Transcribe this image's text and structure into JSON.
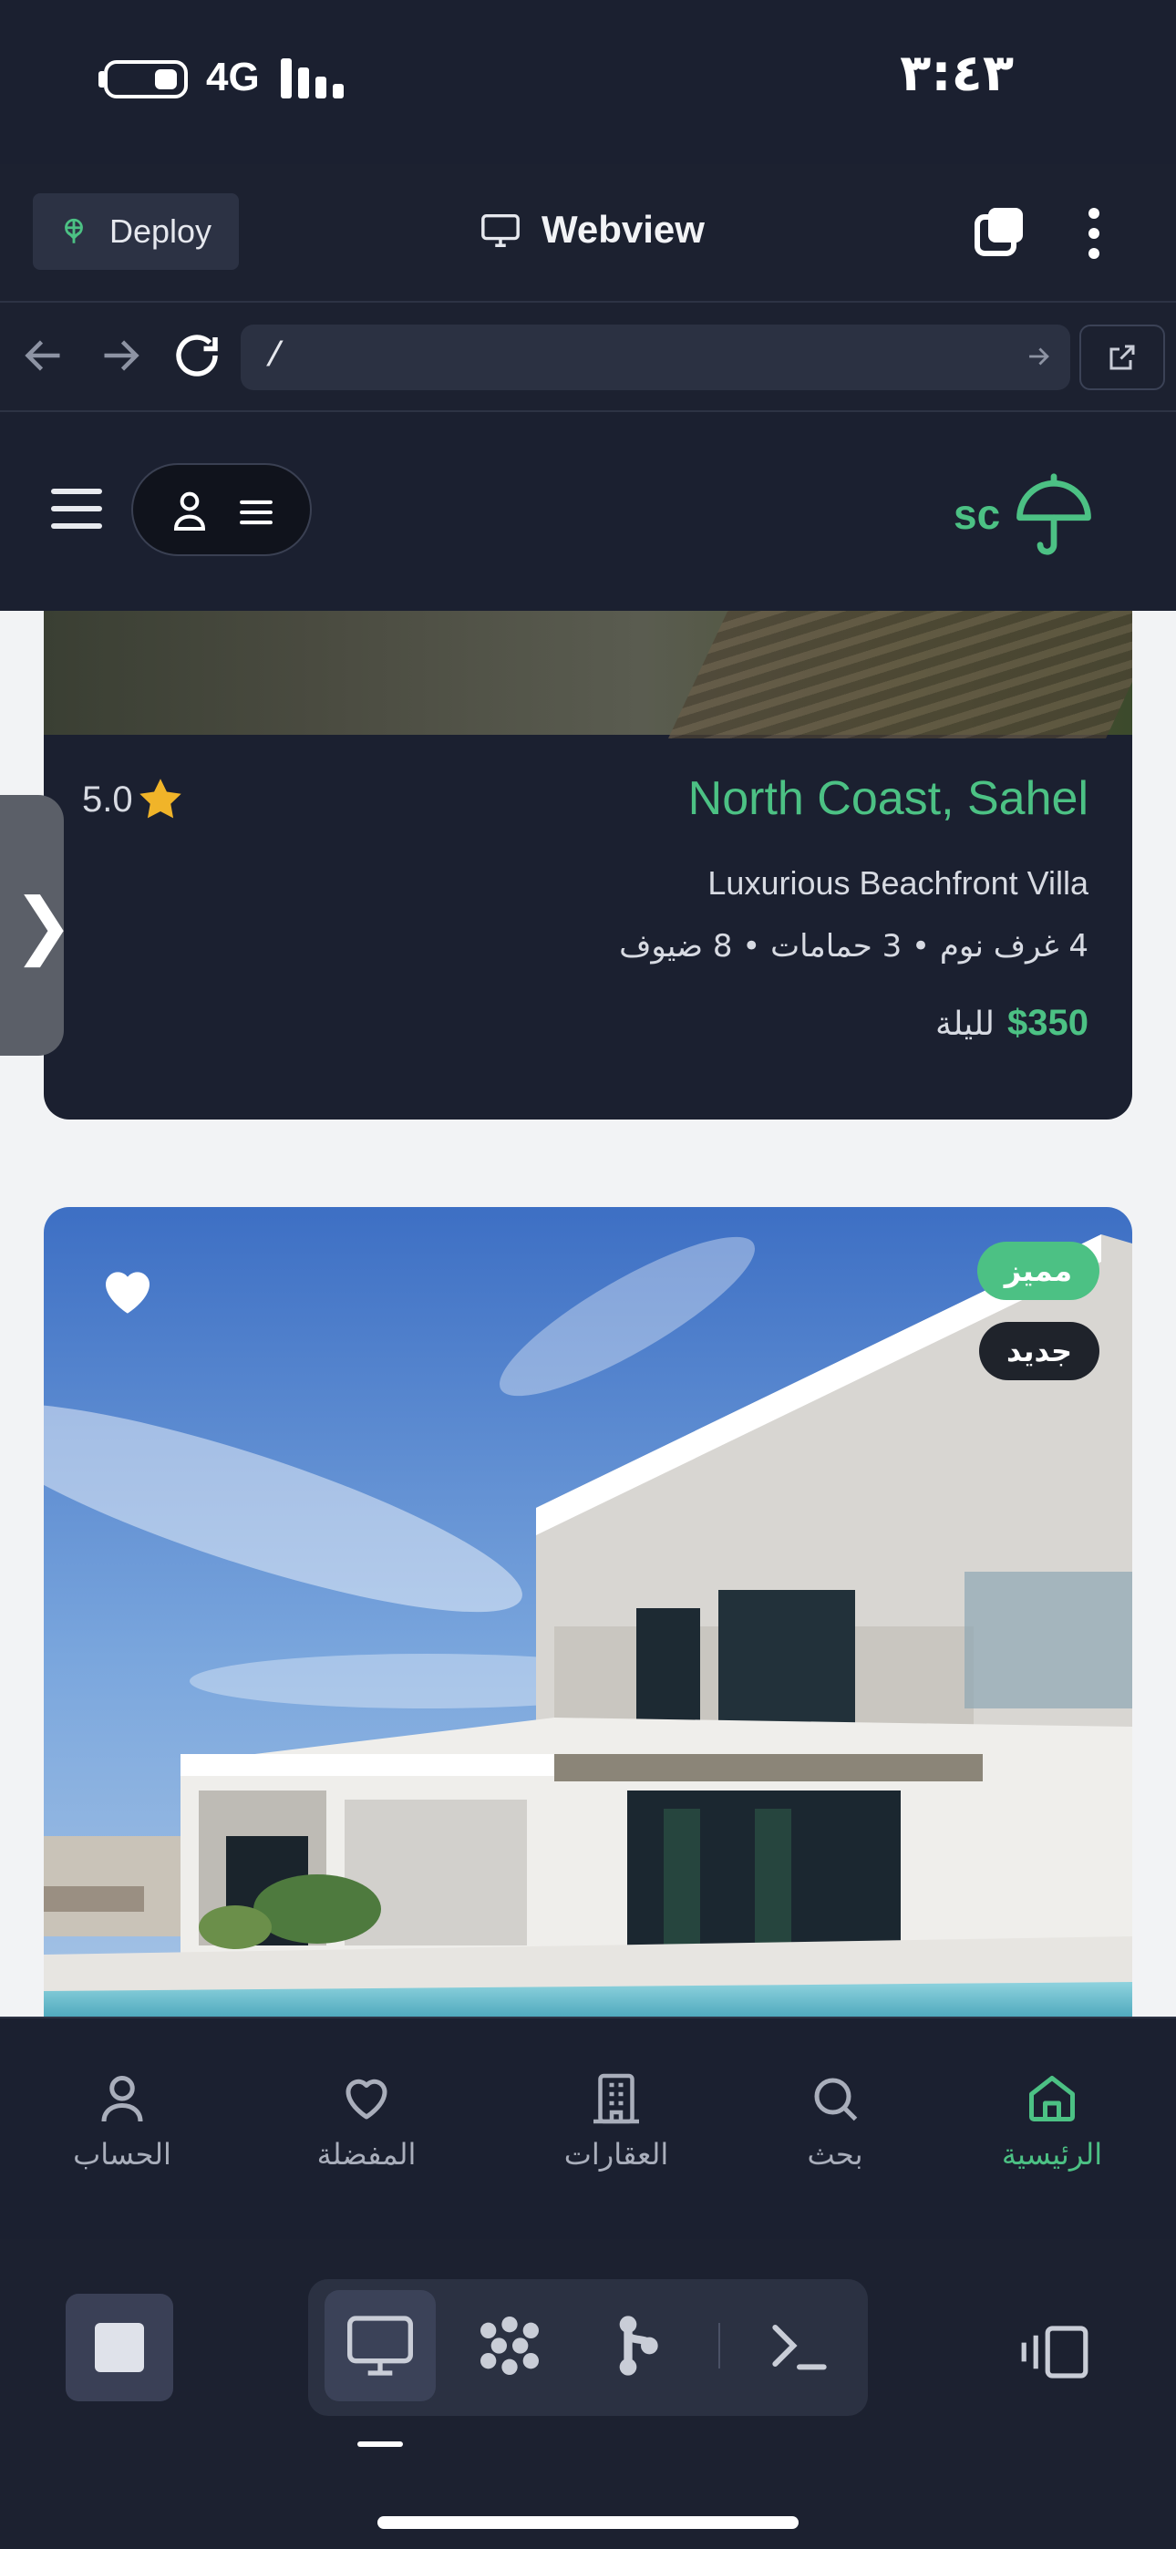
{
  "status_bar": {
    "network": "4G",
    "time": "٣:٤٣"
  },
  "replit_header": {
    "deploy_label": "Deploy",
    "view_title": "Webview"
  },
  "url_bar": {
    "path": "/"
  },
  "app_header": {
    "brand_text": "sc",
    "brand_color": "#4cc184"
  },
  "listing_1": {
    "title": "North Coast, Sahel",
    "rating": "5.0",
    "subtitle": "Luxurious Beachfront Villa",
    "meta": "4 غرف نوم • 3 حمامات • 8 ضيوف",
    "price": "$350",
    "price_unit": "لليلة"
  },
  "listing_2": {
    "badge_featured": "مميز",
    "badge_new": "جديد"
  },
  "side_tab": {
    "glyph": "❯"
  },
  "bottom_nav": {
    "items": [
      {
        "label": "الرئيسية",
        "icon": "home-icon",
        "active": true
      },
      {
        "label": "بحث",
        "icon": "search-icon",
        "active": false
      },
      {
        "label": "العقارات",
        "icon": "building-icon",
        "active": false
      },
      {
        "label": "المفضلة",
        "icon": "heart-icon",
        "active": false
      },
      {
        "label": "الحساب",
        "icon": "user-icon",
        "active": false
      }
    ]
  },
  "replit_toolbar": {
    "tools": [
      "webview-icon",
      "agent-icon",
      "git-icon",
      "shell-icon"
    ]
  },
  "colors": {
    "accent": "#4cc184",
    "dark_surface": "#1b2030",
    "star": "#f0b429"
  }
}
